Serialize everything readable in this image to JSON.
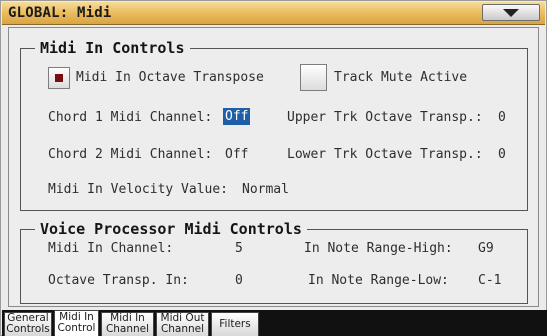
{
  "title": "GLOBAL: Midi",
  "midi_in_controls": {
    "legend": "Midi In Controls",
    "octave_transpose_label": "Midi In Octave Transpose",
    "octave_transpose_checked": true,
    "track_mute_label": "Track Mute Active",
    "track_mute_checked": false,
    "chord1_label": "Chord 1 Midi Channel:",
    "chord1_value": "Off",
    "chord2_label": "Chord 2 Midi Channel:",
    "chord2_value": "Off",
    "upper_trk_label": "Upper Trk Octave Transp.:",
    "upper_trk_value": "0",
    "lower_trk_label": "Lower Trk Octave Transp.:",
    "lower_trk_value": "0",
    "velocity_label": "Midi In Velocity Value:",
    "velocity_value": "Normal"
  },
  "voice_processor": {
    "legend": "Voice Processor Midi Controls",
    "midi_in_channel_label": "Midi In Channel:",
    "midi_in_channel_value": "5",
    "octave_transp_label": "Octave Transp. In:",
    "octave_transp_value": "0",
    "note_high_label": "In Note Range-High:",
    "note_high_value": "G9",
    "note_low_label": "In Note Range-Low:",
    "note_low_value": "C-1"
  },
  "tabs": [
    {
      "line1": "General",
      "line2": "Controls",
      "active": false
    },
    {
      "line1": "Midi In",
      "line2": "Control",
      "active": true
    },
    {
      "line1": "Midi In",
      "line2": "Channel",
      "active": false
    },
    {
      "line1": "Midi Out",
      "line2": "Channel",
      "active": false
    },
    {
      "line1": "Filters",
      "line2": "",
      "active": false
    }
  ],
  "colors": {
    "title_bar": "#e9b95a",
    "highlight": "#1e5fa8",
    "checkbox_mark": "#7a0f12"
  }
}
